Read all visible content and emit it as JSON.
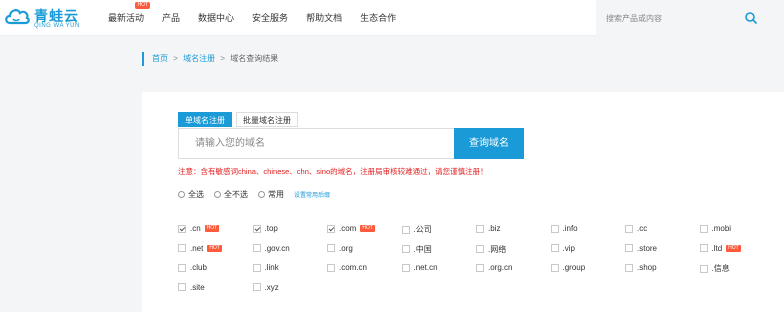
{
  "header": {
    "logo_cn": "青蛙云",
    "logo_en": "QING WA YUN",
    "nav": [
      {
        "label": "最新活动",
        "badge": "HOT"
      },
      {
        "label": "产品",
        "badge": ""
      },
      {
        "label": "数据中心",
        "badge": ""
      },
      {
        "label": "安全服务",
        "badge": ""
      },
      {
        "label": "帮助文档",
        "badge": ""
      },
      {
        "label": "生态合作",
        "badge": ""
      }
    ],
    "search_placeholder": "搜索产品或内容",
    "search_icon": "search-icon"
  },
  "breadcrumb": {
    "home": "首页",
    "sep1": ">",
    "register": "域名注册",
    "sep2": ">",
    "current": "域名查询结果"
  },
  "tabs": {
    "single": "单域名注册",
    "batch": "批量域名注册"
  },
  "query": {
    "input_placeholder": "请输入您的域名",
    "button": "查询域名"
  },
  "notice": "注意：含有敏感词china、chinese、chn、sino的域名，注册局审核较难通过，请您谨慎注册！",
  "select_options": {
    "all": "全选",
    "none": "全不选",
    "common": "常用",
    "set_common": "设置常用后缀"
  },
  "suffixes": [
    [
      {
        "name": ".cn",
        "checked": true,
        "hot": "HOT"
      },
      {
        "name": ".top",
        "checked": true,
        "hot": ""
      },
      {
        "name": ".com",
        "checked": true,
        "hot": "HOT"
      },
      {
        "name": ".公司",
        "checked": false,
        "hot": ""
      },
      {
        "name": ".biz",
        "checked": false,
        "hot": ""
      },
      {
        "name": ".info",
        "checked": false,
        "hot": ""
      },
      {
        "name": ".cc",
        "checked": false,
        "hot": ""
      },
      {
        "name": ".mobi",
        "checked": false,
        "hot": ""
      }
    ],
    [
      {
        "name": ".net",
        "checked": false,
        "hot": "HOT"
      },
      {
        "name": ".gov.cn",
        "checked": false,
        "hot": ""
      },
      {
        "name": ".org",
        "checked": false,
        "hot": ""
      },
      {
        "name": ".中国",
        "checked": false,
        "hot": ""
      },
      {
        "name": ".网络",
        "checked": false,
        "hot": ""
      },
      {
        "name": ".vip",
        "checked": false,
        "hot": ""
      },
      {
        "name": ".store",
        "checked": false,
        "hot": ""
      },
      {
        "name": ".ltd",
        "checked": false,
        "hot": "HOT"
      }
    ],
    [
      {
        "name": ".club",
        "checked": false,
        "hot": ""
      },
      {
        "name": ".link",
        "checked": false,
        "hot": ""
      },
      {
        "name": ".com.cn",
        "checked": false,
        "hot": ""
      },
      {
        "name": ".net.cn",
        "checked": false,
        "hot": ""
      },
      {
        "name": ".org.cn",
        "checked": false,
        "hot": ""
      },
      {
        "name": ".group",
        "checked": false,
        "hot": ""
      },
      {
        "name": ".shop",
        "checked": false,
        "hot": ""
      },
      {
        "name": ".信息",
        "checked": false,
        "hot": ""
      }
    ],
    [
      {
        "name": ".site",
        "checked": false,
        "hot": ""
      },
      {
        "name": ".xyz",
        "checked": false,
        "hot": ""
      }
    ]
  ],
  "colors": {
    "accent": "#1a9ad6",
    "hot": "#ff5a3c",
    "notice": "#e02020"
  }
}
